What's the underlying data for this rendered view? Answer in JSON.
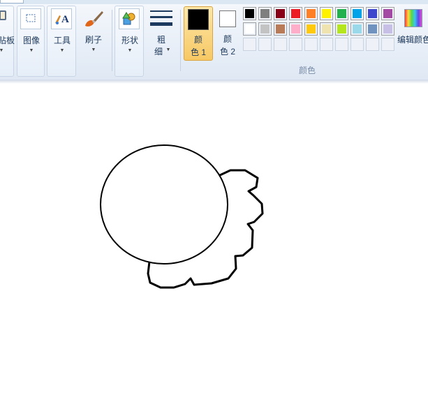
{
  "ribbon": {
    "clipboard_label": "粘贴板",
    "image_label": "图像",
    "tools_label": "工具",
    "brush_label": "刷子",
    "shapes_label": "形状",
    "size_label_1": "粗",
    "size_label_2": "细",
    "color1_label_1": "颜",
    "color1_label_2": "色 1",
    "color2_label_1": "颜",
    "color2_label_2": "色 2",
    "edit_colors_label": "编辑颜色",
    "colors_group_label": "颜色",
    "dropdown_caret": "▼"
  },
  "colors": {
    "active_color1": "#000000",
    "active_color2": "#ffffff",
    "palette_row1": [
      "#000000",
      "#7f7f7f",
      "#880015",
      "#ed1c24",
      "#ff7f27",
      "#fff200",
      "#22b14c",
      "#00a2e8",
      "#3f48cc",
      "#a349a4"
    ],
    "palette_row2": [
      "#ffffff",
      "#c3c3c3",
      "#b97a57",
      "#ffaec9",
      "#ffc90e",
      "#efe4b0",
      "#b5e61d",
      "#99d9ea",
      "#7092be",
      "#c8bfe7"
    ],
    "palette_row3": [
      "",
      "",
      "",
      "",
      "",
      "",
      "",
      "",
      "",
      ""
    ]
  }
}
